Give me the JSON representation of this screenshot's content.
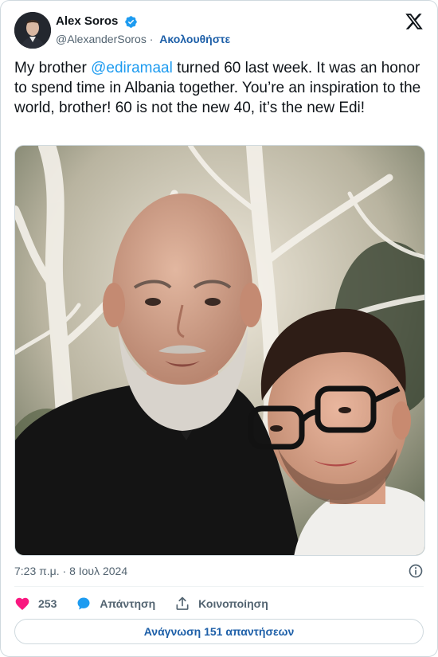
{
  "author": {
    "display_name": "Alex Soros",
    "handle": "@AlexanderSoros",
    "follow_label": "Ακολουθήστε",
    "verified_icon": "verified-badge-icon"
  },
  "tweet": {
    "text_before": "My brother ",
    "mention": "@ediramaal",
    "text_after": " turned 60 last week. It was an honor to spend time in Albania together. You’re an inspiration to the world, brother! 60 is not the new 40, it’s the new Edi!"
  },
  "meta": {
    "timestamp": "7:23 π.μ. · 8 Ιουλ 2024"
  },
  "actions": {
    "like_count": "253",
    "reply_label": "Απάντηση",
    "share_label": "Κοινοποίηση"
  },
  "read_replies_label": "Ανάγνωση 151 απαντήσεων",
  "colors": {
    "accent": "#1d9bf0",
    "link_dark": "#1d5fa8",
    "like": "#f91880",
    "muted": "#536471",
    "border": "#cfd9de"
  }
}
